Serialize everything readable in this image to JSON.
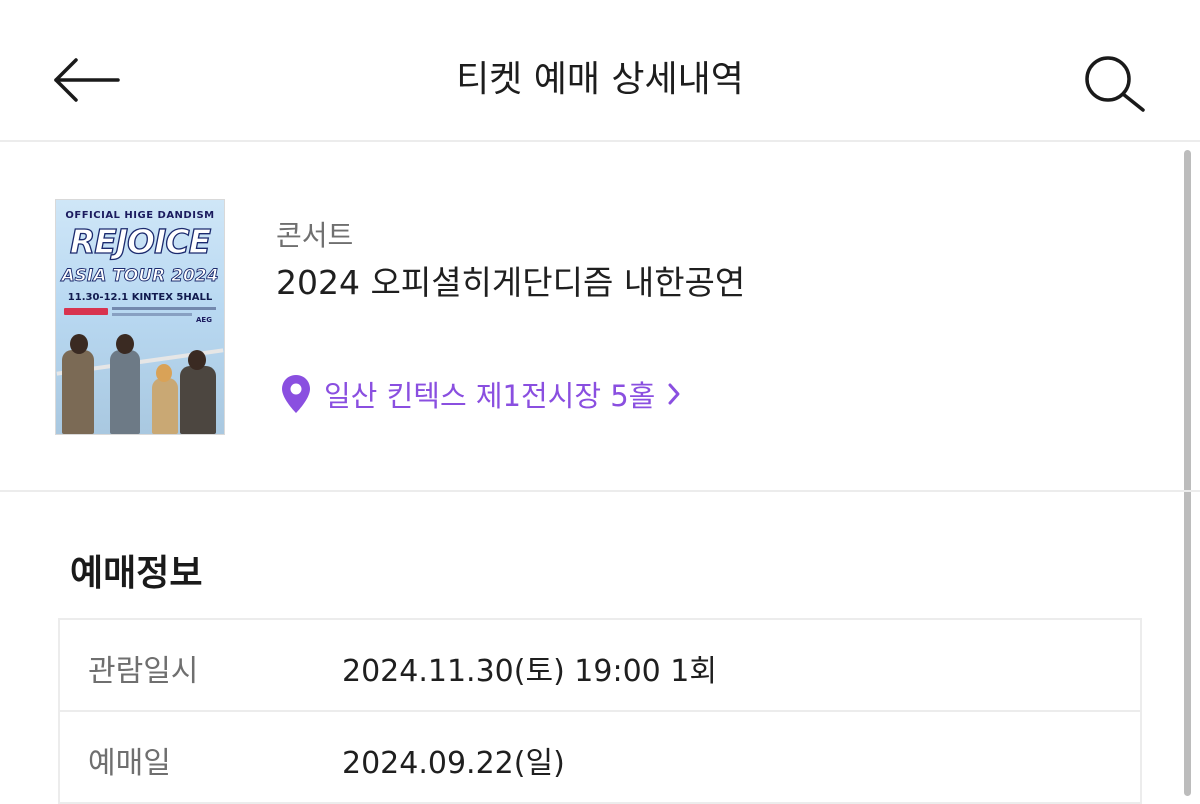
{
  "header": {
    "title": "티켓 예매 상세내역",
    "back_icon": "arrow-left-icon",
    "search_icon": "search-icon"
  },
  "event": {
    "category": "콘서트",
    "title": "2024 오피셜히게단디즘 내한공연",
    "venue": "일산 킨텍스 제1전시장 5홀",
    "venue_icon": "location-pin-icon",
    "venue_color": "#8a4fe0",
    "poster": {
      "line1": "OFFICIAL HIGE DANDISM",
      "line2": "REJOICE",
      "line3": "ASIA TOUR 2024",
      "line4": "11.30-12.1 KINTEX 5HALL",
      "logo": "AEG"
    }
  },
  "booking": {
    "heading": "예매정보",
    "rows": [
      {
        "label": "관람일시",
        "value": "2024.11.30(토) 19:00 1회"
      },
      {
        "label": "예매일",
        "value": "2024.09.22(일)"
      }
    ]
  }
}
